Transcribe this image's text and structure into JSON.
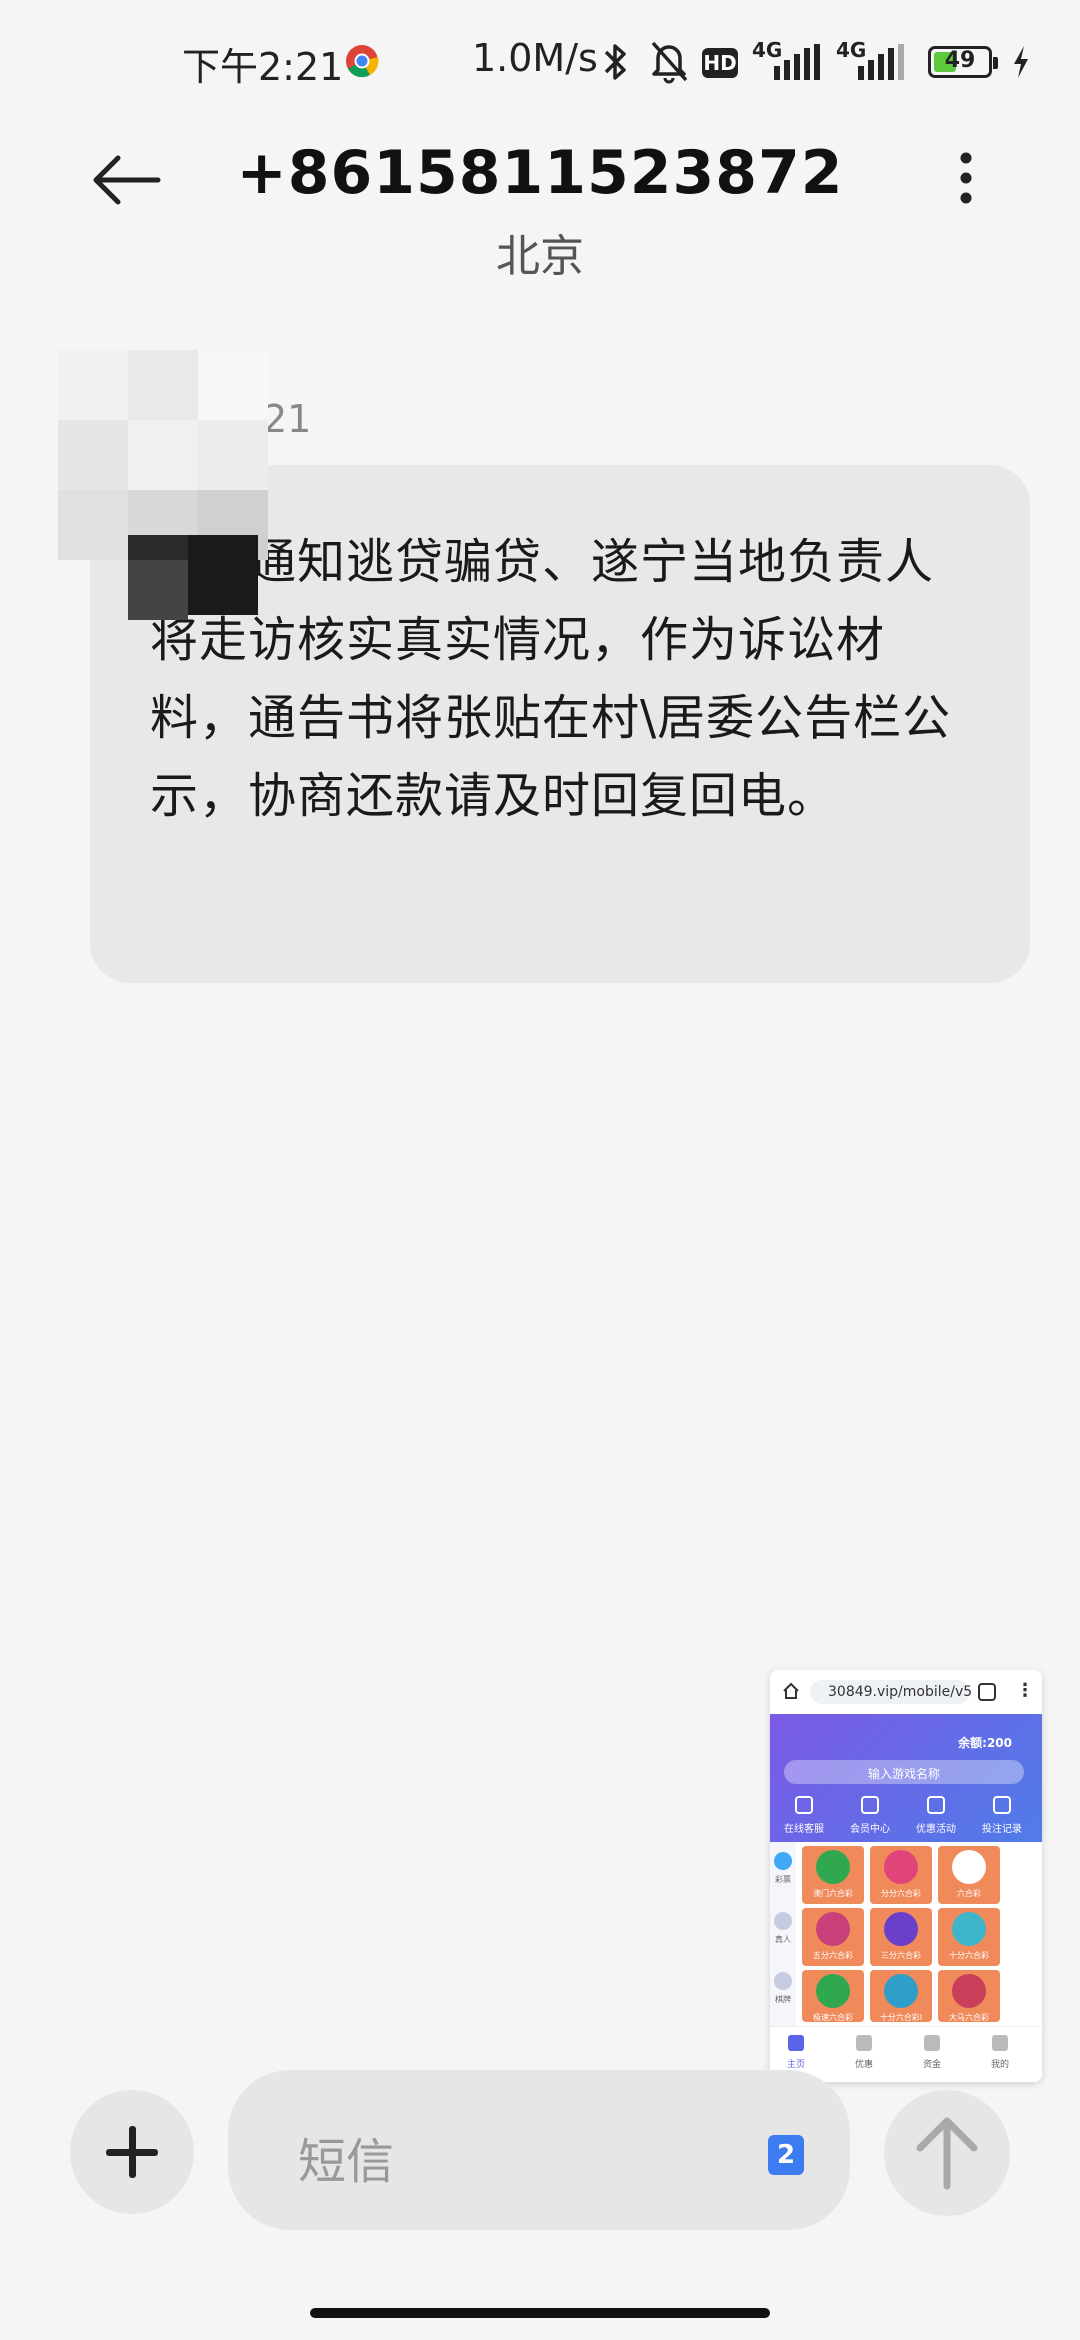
{
  "status_bar": {
    "time": "下午2:21",
    "net_speed": "1.0M/s",
    "hd": "HD",
    "network_1": "4G",
    "network_2": "4G",
    "battery": "49",
    "battery_level": 0.49
  },
  "header": {
    "phone_number": "+8615811523872",
    "location": "北京"
  },
  "message": {
    "time": "下午2:21",
    "text": "多次通知逃贷骗贷、遂宁当地负责人将走访核实真实情况，作为诉讼材料，通告书将张贴在村\\居委公告栏公示，协商还款请及时回复回电。"
  },
  "thumbnail": {
    "url": "30849.vip/mobile/v5",
    "balance": "余额:200",
    "search_placeholder": "输入游戏名称",
    "nav": [
      "在线客服",
      "会员中心",
      "优惠活动",
      "投注记录"
    ],
    "side": [
      "彩票",
      "真人",
      "棋牌"
    ],
    "cards": [
      "澳门六合彩",
      "分分六合彩",
      "六合彩",
      "五分六合彩",
      "三分六合彩",
      "十分六合彩",
      "极速六合彩",
      "十分六合彩I",
      "大马六合彩"
    ],
    "tabs": [
      "主页",
      "优惠",
      "资金",
      "我的"
    ]
  },
  "composer": {
    "placeholder": "短信",
    "sim": "2"
  },
  "colors": {
    "bubble": "#e8e8e8",
    "background": "#f5f5f5",
    "sim_badge": "#3d7bf0",
    "battery_fill": "#5cc83c"
  }
}
